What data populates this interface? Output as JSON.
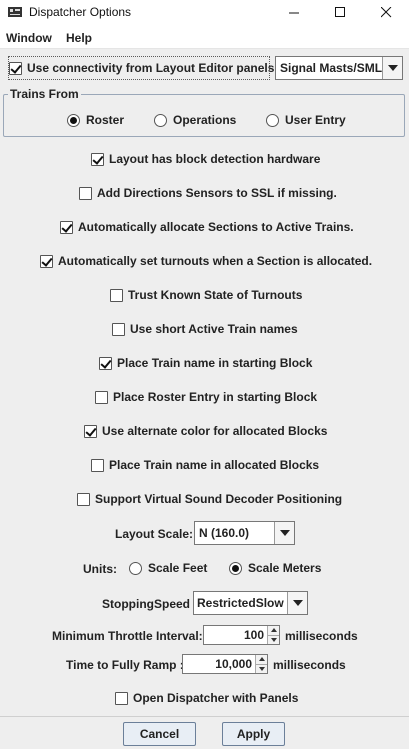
{
  "window": {
    "title": "Dispatcher Options",
    "minimize_icon": "minimize-icon",
    "maximize_icon": "maximize-icon",
    "close_icon": "close-icon"
  },
  "menu": [
    "Window",
    "Help"
  ],
  "connectivity": {
    "label": "Use connectivity from Layout Editor panels",
    "checked": true,
    "signal_select": "Signal Masts/SML"
  },
  "trains_from": {
    "legend": "Trains From",
    "options": [
      "Roster",
      "Operations",
      "User Entry"
    ],
    "selected": "Roster"
  },
  "checkboxes": [
    {
      "label": "Layout has block detection hardware",
      "checked": true
    },
    {
      "label": "Add Directions Sensors to SSL if missing.",
      "checked": false
    },
    {
      "label": "Automatically allocate Sections to Active Trains.",
      "checked": true
    },
    {
      "label": "Automatically set turnouts when a Section is allocated.",
      "checked": true
    },
    {
      "label": "Trust Known State of Turnouts",
      "checked": false
    },
    {
      "label": "Use short Active Train names",
      "checked": false
    },
    {
      "label": "Place Train name in starting Block",
      "checked": true
    },
    {
      "label": "Place Roster Entry in starting Block",
      "checked": false
    },
    {
      "label": "Use alternate color for allocated Blocks",
      "checked": true
    },
    {
      "label": "Place Train name in allocated Blocks",
      "checked": false
    },
    {
      "label": "Support Virtual Sound Decoder Positioning",
      "checked": false
    }
  ],
  "layout_scale": {
    "label": "Layout Scale:",
    "value": "N (160.0)"
  },
  "units": {
    "label": "Units:",
    "options": [
      "Scale Feet",
      "Scale Meters"
    ],
    "selected": "Scale Meters"
  },
  "stopping_speed": {
    "label": "StoppingSpeed",
    "value": "RestrictedSlow"
  },
  "min_throttle": {
    "label": "Minimum Throttle Interval:",
    "value": "100",
    "unit": "milliseconds"
  },
  "ramp": {
    "label": "Time to Fully Ramp :",
    "value": "10,000",
    "unit": "milliseconds"
  },
  "open_with_panels": {
    "label": "Open Dispatcher with Panels",
    "checked": false
  },
  "buttons": {
    "cancel": "Cancel",
    "apply": "Apply"
  }
}
